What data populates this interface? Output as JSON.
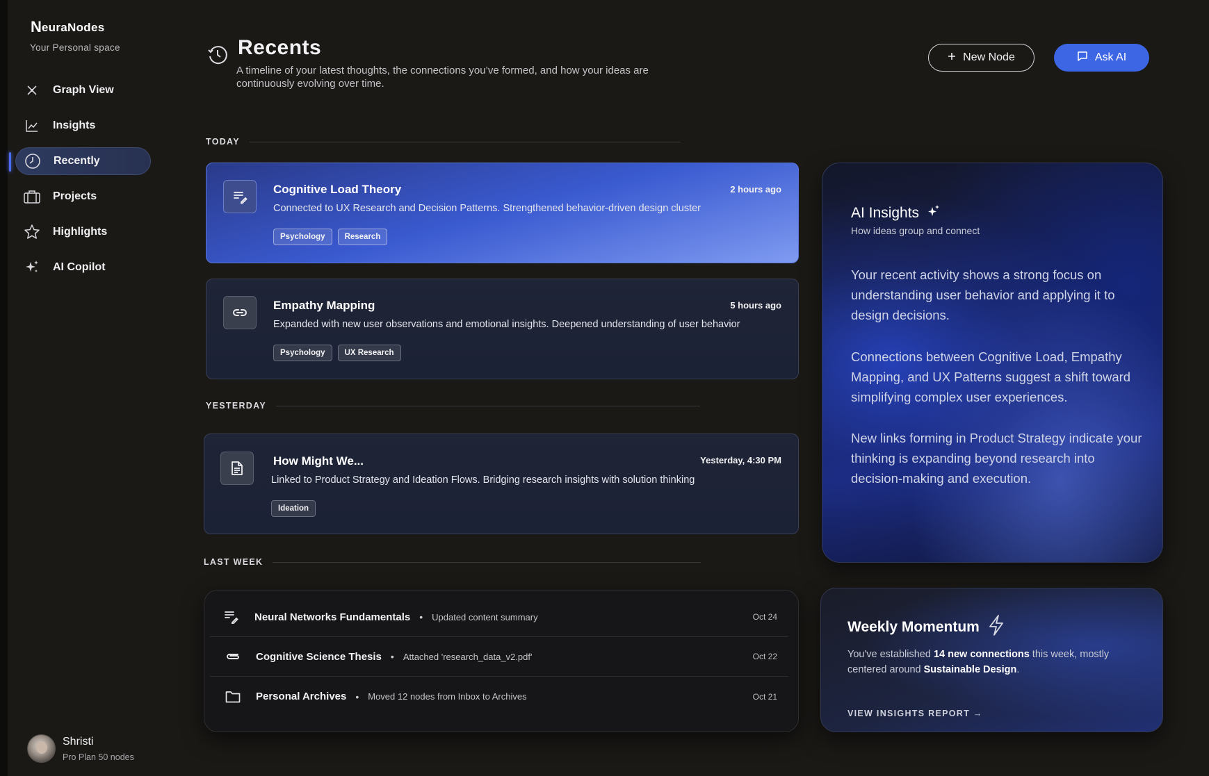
{
  "app": {
    "logo_mark": "N",
    "logo_text": "euraNodes",
    "tagline": "Your Personal space"
  },
  "sidebar": {
    "items": [
      {
        "label": "Graph View",
        "icon": "graph-icon"
      },
      {
        "label": "Insights",
        "icon": "chart-icon"
      },
      {
        "label": "Recently",
        "icon": "clock-icon",
        "active": true
      },
      {
        "label": "Projects",
        "icon": "briefcase-icon"
      },
      {
        "label": "Highlights",
        "icon": "star-icon"
      },
      {
        "label": "AI Copilot",
        "icon": "sparkle-icon"
      }
    ]
  },
  "user": {
    "name": "Shristi",
    "plan": "Pro Plan 50 nodes"
  },
  "header": {
    "title": "Recents",
    "description": "A timeline of your latest thoughts, the connections you’ve formed, and how your ideas are continuously evolving over time.",
    "new_node_label": "New Node",
    "ask_ai_label": "Ask AI"
  },
  "sections": {
    "today": "TODAY",
    "yesterday": "YESTERDAY",
    "last_week": "LAST WEEK"
  },
  "today_cards": [
    {
      "title": "Cognitive Load Theory",
      "time": "2 hours ago",
      "desc": "Connected to UX Research and Decision Patterns. Strengthened behavior-driven design cluster",
      "tags": [
        "Psychology",
        "Research"
      ],
      "icon": "edit-note-icon"
    },
    {
      "title": "Empathy Mapping",
      "time": "5 hours ago",
      "desc": "Expanded with new user observations and emotional insights. Deepened understanding of user behavior",
      "tags": [
        "Psychology",
        "UX Research"
      ],
      "icon": "link-icon"
    }
  ],
  "yesterday_cards": [
    {
      "title": "How Might We...",
      "time": "Yesterday, 4:30 PM",
      "desc": "Linked to Product Strategy and Ideation Flows. Bridging research insights with solution thinking",
      "tags": [
        "Ideation"
      ],
      "icon": "document-icon"
    }
  ],
  "last_week": [
    {
      "name": "Neural Networks Fundamentals",
      "action": "Updated content summary",
      "date": "Oct 24",
      "icon": "edit-note-icon"
    },
    {
      "name": "Cognitive Science Thesis",
      "action": "Attached 'research_data_v2.pdf'",
      "date": "Oct 22",
      "icon": "paperclip-icon"
    },
    {
      "name": "Personal Archives",
      "action": "Moved 12 nodes from Inbox to Archives",
      "date": "Oct 21",
      "icon": "folder-icon"
    }
  ],
  "ai_insights": {
    "title": "AI Insights",
    "subtitle": "How ideas group and connect",
    "paragraphs": [
      "Your recent activity shows a strong focus on understanding user behavior and applying it to design decisions.",
      "Connections between Cognitive Load, Empathy Mapping, and UX Patterns suggest a shift toward simplifying complex user experiences.",
      "New links forming in Product Strategy indicate your thinking is expanding beyond research into decision-making and execution."
    ]
  },
  "momentum": {
    "title": "Weekly Momentum",
    "text_before": "You've established ",
    "highlight_connections": "14 new connections",
    "text_middle": " this week, mostly centered around ",
    "highlight_topic": "Sustainable Design",
    "text_after": ".",
    "link": "VIEW INSIGHTS REPORT →"
  },
  "colors": {
    "background": "#1a1916",
    "accent": "#3d66e4",
    "active_nav": "#2d3a5e"
  }
}
